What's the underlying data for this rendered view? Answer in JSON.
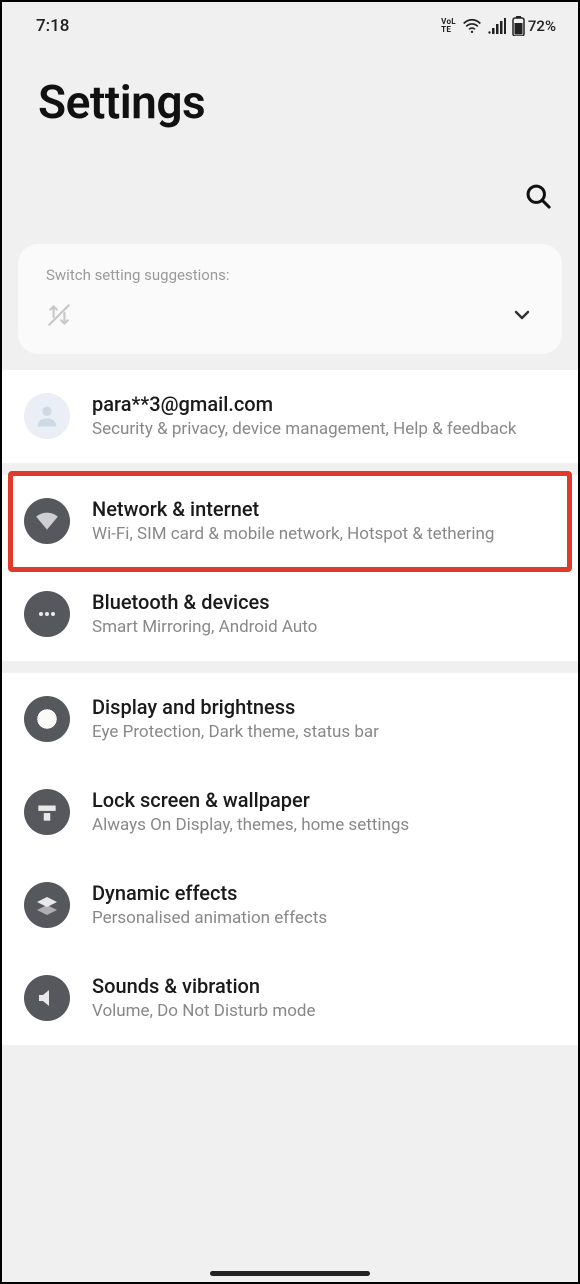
{
  "status": {
    "time": "7:18",
    "battery": "72%"
  },
  "header": {
    "title": "Settings"
  },
  "suggestion": {
    "label": "Switch setting suggestions:"
  },
  "account": {
    "email": "para**3@gmail.com",
    "sub": "Security & privacy, device management, Help & feedback"
  },
  "items": {
    "network": {
      "title": "Network & internet",
      "sub": "Wi-Fi, SIM card & mobile network, Hotspot & tethering"
    },
    "bluetooth": {
      "title": "Bluetooth & devices",
      "sub": "Smart Mirroring, Android Auto"
    },
    "display": {
      "title": "Display and brightness",
      "sub": "Eye Protection, Dark theme, status bar"
    },
    "lockscreen": {
      "title": "Lock screen & wallpaper",
      "sub": "Always On Display, themes, home settings"
    },
    "dynamic": {
      "title": "Dynamic effects",
      "sub": "Personalised animation effects"
    },
    "sounds": {
      "title": "Sounds & vibration",
      "sub": "Volume, Do Not Disturb mode"
    }
  }
}
